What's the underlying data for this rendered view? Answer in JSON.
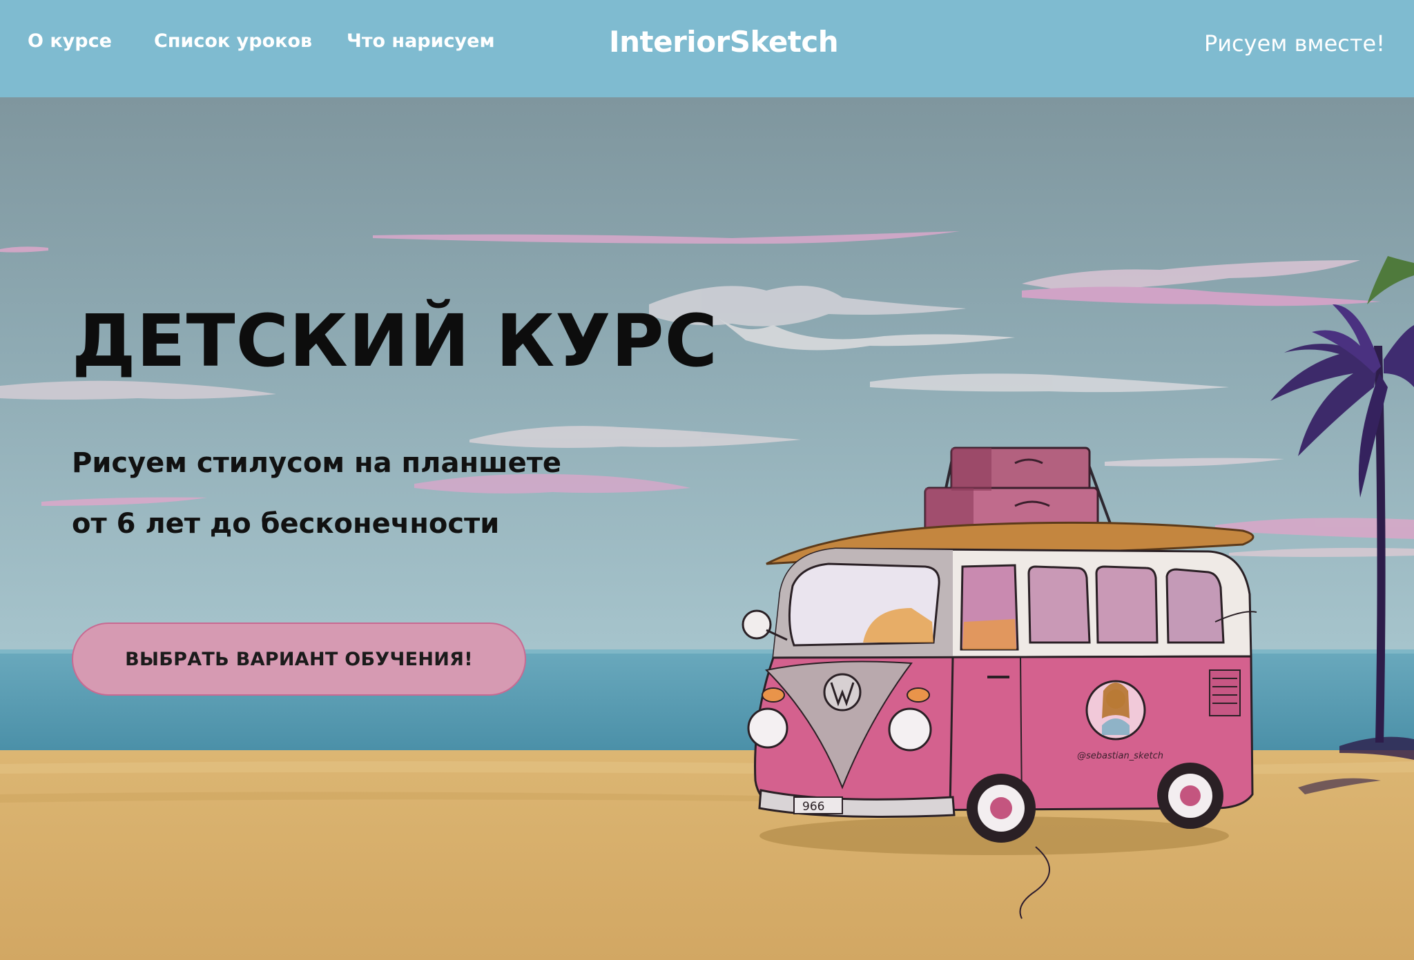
{
  "header": {
    "nav": [
      {
        "label": "О курсе"
      },
      {
        "label": "Список уроков"
      },
      {
        "label": "Что нарисуем"
      }
    ],
    "brand": "InteriorSketch",
    "tagline": "Рисуем вместе!"
  },
  "hero": {
    "title": "ДЕТСКИЙ КУРС",
    "subtitle_line1": "Рисуем стилусом на планшете",
    "subtitle_line2": "от 6 лет до бесконечности",
    "cta_label": "ВЫБРАТЬ ВАРИАНТ ОБУЧЕНИЯ!"
  },
  "colors": {
    "header_bg": "#7fbbd0",
    "cta_bg": "#d69ab2",
    "van_pink": "#d4618e",
    "sand": "#d6ae68",
    "sea": "#5b9fb6"
  },
  "illustration": {
    "van_plate": "966",
    "van_handle": "@sebastian_sketch"
  }
}
